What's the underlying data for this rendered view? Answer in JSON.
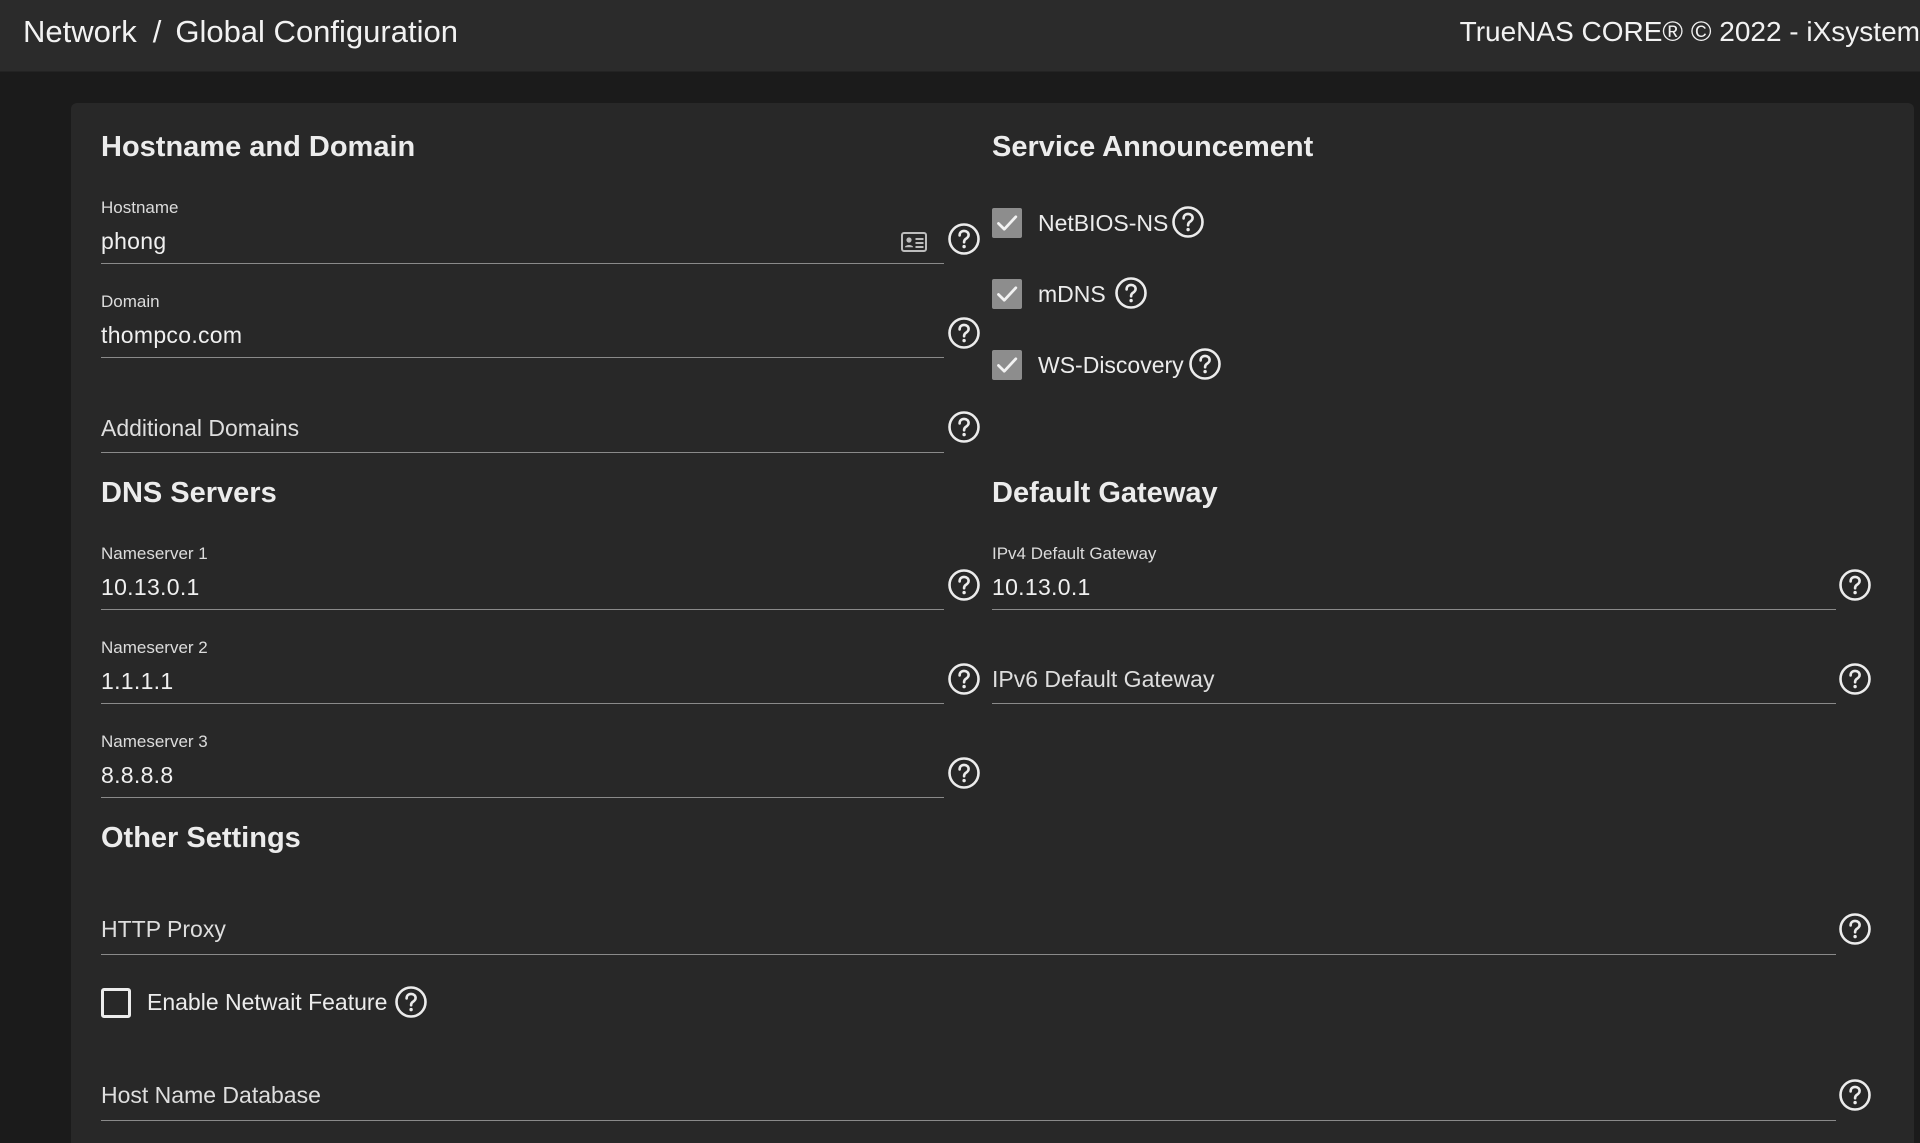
{
  "header": {
    "breadcrumb_parent": "Network",
    "breadcrumb_separator": "/",
    "breadcrumb_current": "Global Configuration",
    "copyright": "TrueNAS CORE® © 2022 - iXsystem"
  },
  "hostname_domain": {
    "title": "Hostname and Domain",
    "hostname_label": "Hostname",
    "hostname_value": "phong",
    "domain_label": "Domain",
    "domain_value": "thompco.com",
    "additional_domains_placeholder": "Additional Domains"
  },
  "service_announcement": {
    "title": "Service Announcement",
    "items": [
      {
        "label": "NetBIOS-NS",
        "checked": true
      },
      {
        "label": "mDNS",
        "checked": true
      },
      {
        "label": "WS-Discovery",
        "checked": true
      }
    ]
  },
  "dns_servers": {
    "title": "DNS Servers",
    "ns1_label": "Nameserver 1",
    "ns1_value": "10.13.0.1",
    "ns2_label": "Nameserver 2",
    "ns2_value": "1.1.1.1",
    "ns3_label": "Nameserver 3",
    "ns3_value": "8.8.8.8"
  },
  "default_gateway": {
    "title": "Default Gateway",
    "ipv4_label": "IPv4 Default Gateway",
    "ipv4_value": "10.13.0.1",
    "ipv6_placeholder": "IPv6 Default Gateway"
  },
  "other_settings": {
    "title": "Other Settings",
    "http_proxy_placeholder": "HTTP Proxy",
    "netwait_label": "Enable Netwait Feature",
    "netwait_checked": false,
    "host_name_database_placeholder": "Host Name Database"
  },
  "icons": {
    "help": "help-circle-icon",
    "check": "checkmark-icon",
    "contact_card": "contact-card-icon"
  },
  "colors": {
    "background": "#1b1b1b",
    "topbar": "#2b2b2b",
    "card": "#282828",
    "checkbox_checked": "#8d8d8d",
    "text": "#ececec"
  }
}
